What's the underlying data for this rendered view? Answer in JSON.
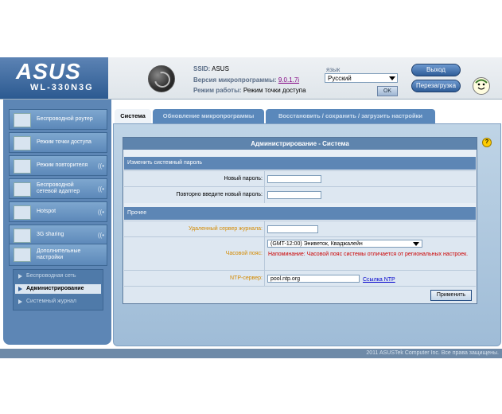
{
  "header": {
    "logo": "ASUS",
    "model": "WL-330N3G",
    "ssid_label": "SSID:",
    "ssid_value": "ASUS",
    "fw_label": "Версия микропрограммы:",
    "fw_value": "9.0.1.7i",
    "mode_label": "Режим работы:",
    "mode_value": "Режим точки доступа",
    "lang_label": "язык",
    "lang_value": "Русский",
    "ok_label": "OK",
    "exit_label": "Выход",
    "reboot_label": "Перезагрузка"
  },
  "sidebar": {
    "items": [
      {
        "label": "Беспроводной роутер"
      },
      {
        "label": "Режим точки доступа"
      },
      {
        "label": "Режим повторителя"
      },
      {
        "label": "Беспроводной сетевой адаптер"
      },
      {
        "label": "Hotspot"
      },
      {
        "label": "3G sharing"
      },
      {
        "label": "Дополнительные настройки"
      }
    ],
    "sub_items": [
      {
        "label": "Беспроводная сеть"
      },
      {
        "label": "Администрирование"
      },
      {
        "label": "Системный журнал"
      }
    ]
  },
  "tabs": [
    {
      "label": "Система"
    },
    {
      "label": "Обновление микропрограммы"
    },
    {
      "label": "Восстановить / сохранить / загрузить настройки"
    }
  ],
  "main": {
    "title": "Администрирование - Система",
    "section1": "Изменить системный пароль",
    "new_password_label": "Новый пароль:",
    "repeat_password_label": "Повторно введите новый пароль:",
    "section2": "Прочее",
    "log_server_label": "Удаленный сервер журнала:",
    "timezone_label": "Часовой пояс:",
    "timezone_value": "(GMT-12:00) Эниветок, Кваджалейн",
    "timezone_note": "Напоминание: Часовой пояс системы отличается от региональных настроек.",
    "ntp_label": "NTP-сервер:",
    "ntp_value": "pool.ntp.org",
    "ntp_link": "Ссылка NTP",
    "apply_label": "Применить"
  },
  "footer": {
    "copyright": "2011 ASUSTek Computer Inc. Все права защищены."
  }
}
